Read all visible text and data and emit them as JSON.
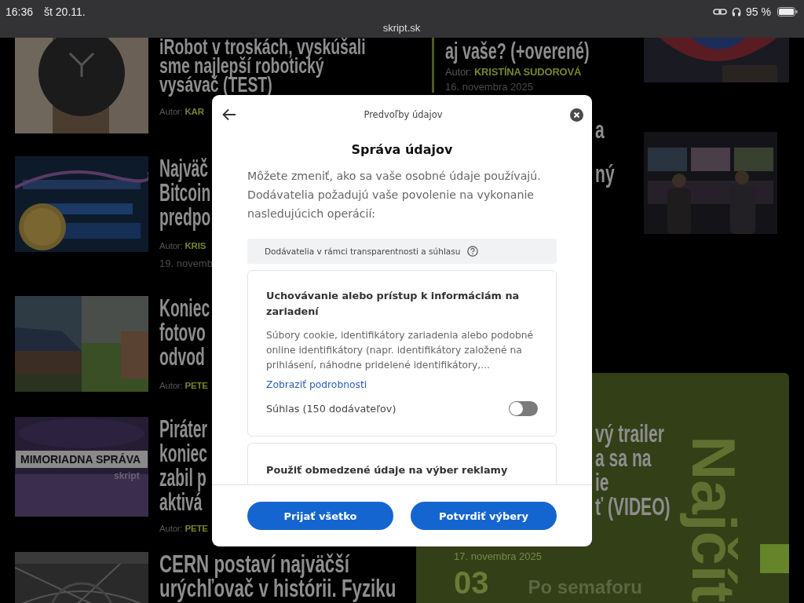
{
  "status_bar": {
    "time": "16:36",
    "date": "št 20.11.",
    "battery": "95 %",
    "url": "skript.sk"
  },
  "articles": [
    {
      "title_lines": [
        "iRobot v troskách, vyskúšali",
        "sme najlepší robotický",
        "vysávač (TEST)"
      ],
      "author_label": "Autor:",
      "author": "KAR"
    },
    {
      "title_lines": [
        "Najväč",
        "Bitcoin",
        "predpo"
      ],
      "author_label": "Autor:",
      "author": "KRIS",
      "date": "19. novemb"
    },
    {
      "title_lines": [
        "Koniec",
        "fotovo",
        "odvod"
      ],
      "author_label": "Autor:",
      "author": "PETE"
    },
    {
      "title_lines": [
        "Piráter",
        "koniec",
        "zabil p",
        "aktivá"
      ],
      "author_label": "Autor:",
      "author": "PETE",
      "banner": {
        "label": "MIMORIADNA SPRÁVA",
        "logo": "skript"
      }
    },
    {
      "title_lines": [
        "CERN postaví najväčší",
        "urýchľovač v histórii. Fyziku"
      ]
    }
  ],
  "featured": {
    "title_line": "aj vaše? (+overené)",
    "author_label": "Autor:",
    "author": "KRISTÍNA SUDOROVÁ",
    "date": "16. novembra 2025",
    "fragments": [
      "a",
      "ný"
    ]
  },
  "most_read": {
    "title_lines": [
      "vý trailer",
      "a sa na",
      "ie",
      "ť (VIDEO)"
    ],
    "date": "17. novembra 2025",
    "rank": "03",
    "next_title": "Po semaforu",
    "vertical_label": "Najčít"
  },
  "dialog": {
    "header": "Predvoľby údajov",
    "title": "Správa údajov",
    "description": "Môžete zmeniť, ako sa vaše osobné údaje používajú. Dodávatelia požadujú vaše povolenie na vykonanie nasledujúcich operácií:",
    "section": "Dodávatelia v rámci transparentnosti a súhlasu",
    "purposes": [
      {
        "title": "Uchovávanie alebo prístup k informáciám na zariadení",
        "description": "Súbory cookie, identifikátory zariadenia alebo podobné online identifikátory (napr. identifikátory založené na prihlásení, náhodne pridelené identifikátory,...",
        "link": "Zobraziť podrobnosti",
        "consent_label": "Súhlas (150 dodávateľov)",
        "on": false
      },
      {
        "title": "Použiť obmedzené údaje na výber reklamy"
      }
    ],
    "buttons": [
      "Prijať všetko",
      "Potvrdiť výbery"
    ]
  }
}
